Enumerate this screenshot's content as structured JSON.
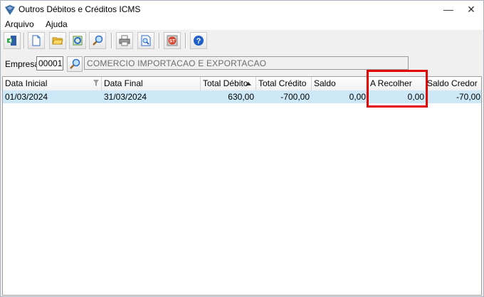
{
  "window": {
    "title": "Outros Débitos e Créditos ICMS",
    "minimize_glyph": "—",
    "close_glyph": "✕"
  },
  "menu": {
    "items": [
      {
        "label": "Arquivo"
      },
      {
        "label": "Ajuda"
      }
    ]
  },
  "toolbar": {
    "buttons": [
      {
        "icon": "exit-door-icon"
      },
      {
        "icon": "new-document-icon"
      },
      {
        "icon": "open-folder-icon"
      },
      {
        "icon": "refresh-icon"
      },
      {
        "icon": "search-icon"
      },
      {
        "icon": "print-icon"
      },
      {
        "icon": "print-preview-icon"
      },
      {
        "icon": "st-badge-icon"
      },
      {
        "icon": "help-icon"
      }
    ]
  },
  "empresa": {
    "label": "Empresa",
    "code": "00001",
    "name": "COMERCIO IMPORTACAO E EXPORTACAO"
  },
  "grid": {
    "columns": [
      {
        "label": "Data Inicial"
      },
      {
        "label": "Data Final"
      },
      {
        "label": "Total Débito"
      },
      {
        "label": "Total Crédito"
      },
      {
        "label": "Saldo"
      },
      {
        "label": "A Recolher"
      },
      {
        "label": "Saldo Credor"
      }
    ],
    "rows": [
      {
        "data_inicial": "01/03/2024",
        "data_final": "31/03/2024",
        "total_debito": "630,00",
        "total_credito": "-700,00",
        "saldo": "0,00",
        "a_recolher": "0,00",
        "saldo_credor": "-70,00"
      }
    ],
    "selected_row_color": "#cde8f6",
    "highlight_color": "#e50000"
  }
}
